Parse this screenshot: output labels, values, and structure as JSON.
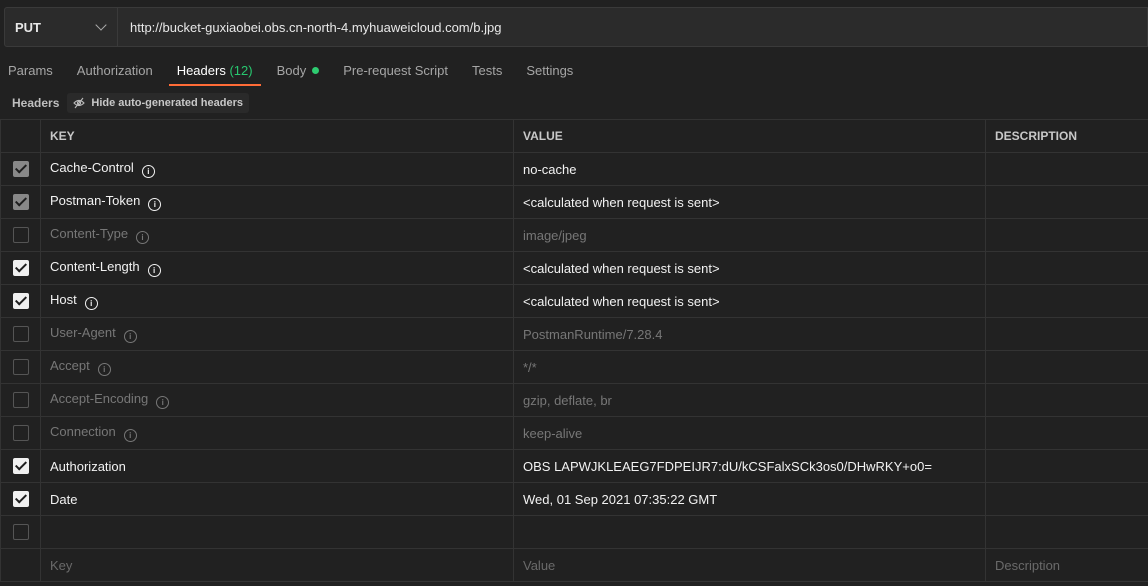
{
  "request": {
    "method": "PUT",
    "url": "http://bucket-guxiaobei.obs.cn-north-4.myhuaweicloud.com/b.jpg"
  },
  "tabs": [
    {
      "label": "Params"
    },
    {
      "label": "Authorization"
    },
    {
      "label": "Headers",
      "count": "(12)",
      "active": true
    },
    {
      "label": "Body",
      "has_dot": true
    },
    {
      "label": "Pre-request Script"
    },
    {
      "label": "Tests"
    },
    {
      "label": "Settings"
    }
  ],
  "subbar": {
    "title": "Headers",
    "toggle_label": "Hide auto-generated headers"
  },
  "table": {
    "columns": [
      "KEY",
      "VALUE",
      "DESCRIPTION"
    ],
    "rows": [
      {
        "state": "locked",
        "key": "Cache-Control",
        "info": true,
        "value": "no-cache"
      },
      {
        "state": "locked",
        "key": "Postman-Token",
        "info": true,
        "value": "<calculated when request is sent>"
      },
      {
        "state": "unchecked",
        "key": "Content-Type",
        "info": true,
        "value": "image/jpeg"
      },
      {
        "state": "checked",
        "key": "Content-Length",
        "info": true,
        "value": "<calculated when request is sent>"
      },
      {
        "state": "checked",
        "key": "Host",
        "info": true,
        "value": "<calculated when request is sent>"
      },
      {
        "state": "unchecked",
        "key": "User-Agent",
        "info": true,
        "value": "PostmanRuntime/7.28.4"
      },
      {
        "state": "unchecked",
        "key": "Accept",
        "info": true,
        "value": "*/*"
      },
      {
        "state": "unchecked",
        "key": "Accept-Encoding",
        "info": true,
        "value": "gzip, deflate, br"
      },
      {
        "state": "unchecked",
        "key": "Connection",
        "info": true,
        "value": "keep-alive"
      },
      {
        "state": "checked",
        "key": "Authorization",
        "info": false,
        "value": "OBS LAPWJKLEAEG7FDPEIJR7:dU/kCSFalxSCk3os0/DHwRKY+o0="
      },
      {
        "state": "checked",
        "key": "Date",
        "info": false,
        "value": "Wed, 01 Sep 2021 07:35:22 GMT"
      },
      {
        "state": "unchecked",
        "key": "",
        "info": false,
        "value": ""
      }
    ],
    "placeholders": {
      "key": "Key",
      "value": "Value",
      "description": "Description"
    }
  },
  "colors": {
    "accent": "#ff6c37",
    "count": "#28c76f",
    "body_dot": "#2ecc71",
    "background": "#212121"
  }
}
